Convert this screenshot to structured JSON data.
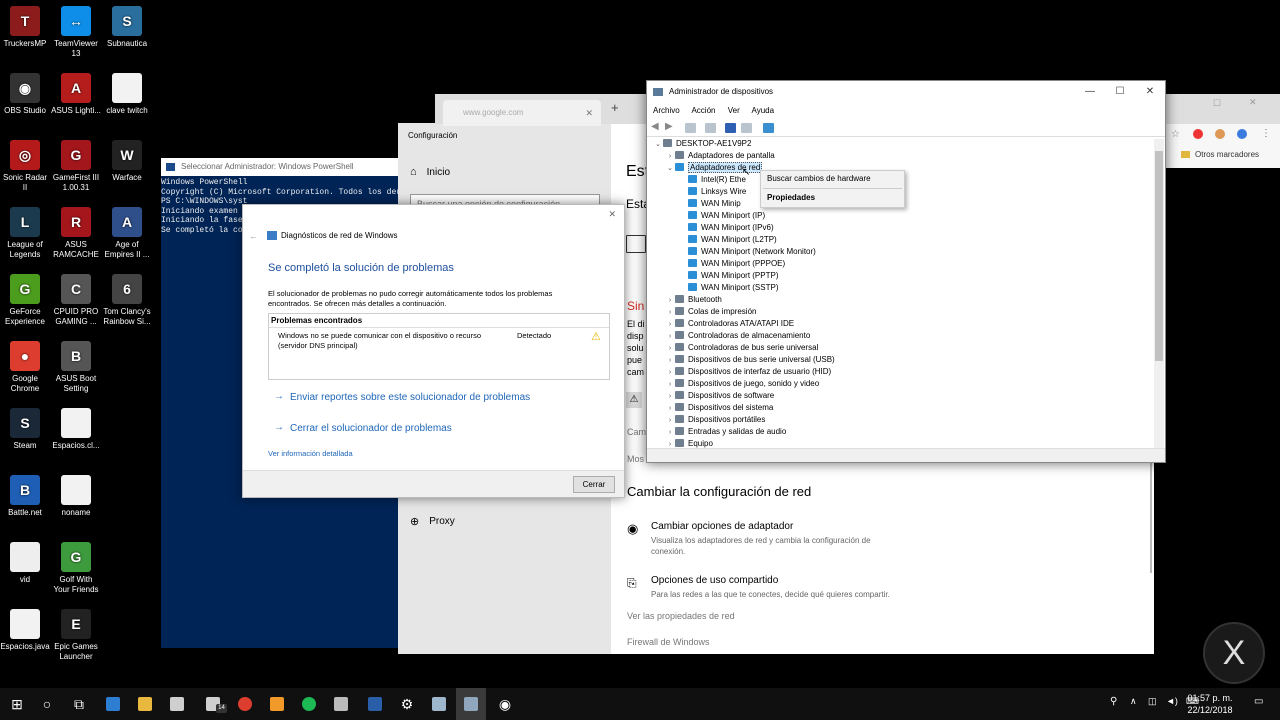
{
  "desktop_icons": [
    {
      "label": "TruckersMP",
      "color": "#8c1c1c",
      "glyph": "T"
    },
    {
      "label": "TeamViewer 13",
      "color": "#0e8ee9",
      "glyph": "↔"
    },
    {
      "label": "Subnautica",
      "color": "#2a6e9e",
      "glyph": "S"
    },
    {
      "label": "OBS Studio",
      "color": "#333333",
      "glyph": "◉"
    },
    {
      "label": "ASUS Lighti...",
      "color": "#b51d1d",
      "glyph": "A"
    },
    {
      "label": "clave twitch",
      "color": "#f2f2f2",
      "glyph": ""
    },
    {
      "label": "Sonic Radar II",
      "color": "#b41a1a",
      "glyph": "◎"
    },
    {
      "label": "GameFirst III 1.00.31",
      "color": "#a3161b",
      "glyph": "G"
    },
    {
      "label": "Warface",
      "color": "#222222",
      "glyph": "W"
    },
    {
      "label": "League of Legends",
      "color": "#1b3a4d",
      "glyph": "L"
    },
    {
      "label": "ASUS RAMCACHE",
      "color": "#a4161b",
      "glyph": "R"
    },
    {
      "label": "Age of Empires II ...",
      "color": "#2e4f8a",
      "glyph": "A"
    },
    {
      "label": "GeForce Experience",
      "color": "#4c9c1d",
      "glyph": "G"
    },
    {
      "label": "CPUID PRO GAMING ...",
      "color": "#555555",
      "glyph": "C"
    },
    {
      "label": "Tom Clancy's Rainbow Si...",
      "color": "#444444",
      "glyph": "6"
    },
    {
      "label": "Google Chrome",
      "color": "#dc3d2e",
      "glyph": "●"
    },
    {
      "label": "ASUS Boot Setting",
      "color": "#555555",
      "glyph": "B"
    },
    {
      "label": "Steam",
      "color": "#1b2838",
      "glyph": "S"
    },
    {
      "label": "Espacios.cl...",
      "color": "#f2f2f2",
      "glyph": ""
    },
    {
      "label": "Battle.net",
      "color": "#1e5fb5",
      "glyph": "B"
    },
    {
      "label": "noname",
      "color": "#f2f2f2",
      "glyph": ""
    },
    {
      "label": "vid",
      "color": "#eeeeee",
      "glyph": ""
    },
    {
      "label": "Golf With Your Friends",
      "color": "#3d9a3d",
      "glyph": "G"
    },
    {
      "label": "Espacios.java",
      "color": "#f2f2f2",
      "glyph": ""
    },
    {
      "label": "Epic Games Launcher",
      "color": "#222222",
      "glyph": "E"
    }
  ],
  "powershell": {
    "title": "Seleccionar Administrador: Windows PowerShell",
    "lines": [
      "Windows PowerShell",
      "Copyright (C) Microsoft Corporation. Todos los dere",
      "",
      "PS C:\\WINDOWS\\syst",
      "",
      "Iniciando examen",
      "",
      "Iniciando la fase",
      "Se completó la co"
    ]
  },
  "settings": {
    "title": "Configuración",
    "home": "Inicio",
    "search_placeholder": "Buscar una opción de configuración",
    "proxy": "Proxy",
    "heading_partial": "Est",
    "subheading_partial": "Esta",
    "sin_partial": "Sin",
    "partial_lines": [
      "El di",
      "disp",
      "solu",
      "pue",
      "cam"
    ],
    "cam_partial": "Cam",
    "mos_partial": "Mos",
    "section_title": "Cambiar la configuración de red",
    "opt1_title": "Cambiar opciones de adaptador",
    "opt1_desc_1": "Visualiza los adaptadores de red y cambia la configuración de",
    "opt1_desc_2": "conexión.",
    "opt2_title": "Opciones de uso compartido",
    "opt2_desc": "Para las redes a las que te conectes, decide qué quieres compartir.",
    "link1": "Ver las propiedades de red",
    "link2": "Firewall de Windows"
  },
  "chrome": {
    "tab_label": "www.google.com",
    "new_tab": "+",
    "bookmarks": "Otros marcadores"
  },
  "diagnostics": {
    "title": "Diagnósticos de red de Windows",
    "heading": "Se completó la solución de problemas",
    "desc": "El solucionador de problemas no pudo corregir automáticamente todos los problemas encontrados. Se ofrecen más detalles a continuación.",
    "problems_header": "Problemas encontrados",
    "problem_text": "Windows no se puede comunicar con el dispositivo o recurso (servidor DNS principal)",
    "problem_status": "Detectado",
    "link1": "Enviar reportes sobre este solucionador de problemas",
    "link2": "Cerrar el solucionador de problemas",
    "details_link": "Ver información detallada",
    "close_button": "Cerrar"
  },
  "device_manager": {
    "title": "Administrador de dispositivos",
    "menu": [
      "Archivo",
      "Acción",
      "Ver",
      "Ayuda"
    ],
    "root": "DESKTOP-AE1V9P2",
    "display_adapters": "Adaptadores de pantalla",
    "network_adapters": "Adaptadores de red",
    "network_children": [
      "Intel(R) Ethe",
      "Linksys Wire",
      "WAN Minip",
      "WAN Miniport (IP)",
      "WAN Miniport (IPv6)",
      "WAN Miniport (L2TP)",
      "WAN Miniport (Network Monitor)",
      "WAN Miniport (PPPOE)",
      "WAN Miniport (PPTP)",
      "WAN Miniport (SSTP)"
    ],
    "categories": [
      "Bluetooth",
      "Colas de impresión",
      "Controladoras ATA/ATAPI IDE",
      "Controladoras de almacenamiento",
      "Controladoras de bus serie universal",
      "Dispositivos de bus serie universal (USB)",
      "Dispositivos de interfaz de usuario (HID)",
      "Dispositivos de juego, sonido y video",
      "Dispositivos de software",
      "Dispositivos del sistema",
      "Dispositivos portátiles",
      "Entradas y salidas de audio",
      "Equipo"
    ],
    "context_menu": {
      "item1": "Buscar cambios de hardware",
      "item2": "Propiedades"
    }
  },
  "taskbar": {
    "time": "01:57 p. m.",
    "date": "22/12/2018",
    "mail_badge": "14"
  }
}
